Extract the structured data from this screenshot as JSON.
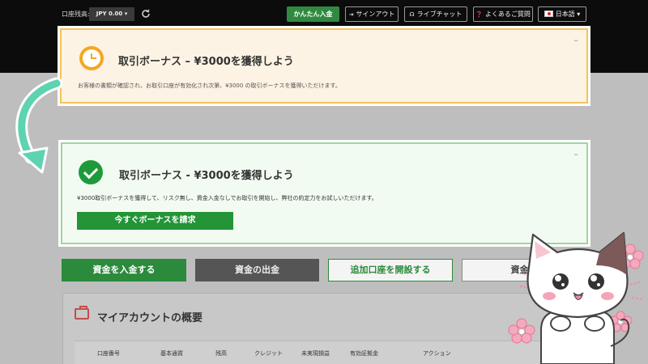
{
  "topbar": {
    "balance_label": "口座残高:",
    "currency": "JPY 0.00 ▾",
    "deposit_label": "かんたん入金",
    "signout_label": "サインアウト",
    "livechat_label": "ライブチャット",
    "faq_label": "よくあるご質問",
    "language_label": "日本語 ▾"
  },
  "pending_bonus": {
    "title": "取引ボーナス – ¥3000を獲得しよう",
    "description": "お客様の書類が確認され、お取引口座が有効化され次第、¥3000 の取引ボーナスを獲得いただけます。",
    "minimize": "–"
  },
  "active_bonus": {
    "title": "取引ボーナス - ¥3000を獲得しよう",
    "description": "¥3000取引ボーナスを獲得して、リスク無し、資金入金なしでお取引を開始し、弊社の約定力をお試しいただけます。",
    "claim_label": "今すぐボーナスを請求",
    "minimize": "–"
  },
  "actions": {
    "deposit": "資金を入金する",
    "withdraw": "資金の出金",
    "open_account": "追加口座を開設する",
    "transfer": "資金移"
  },
  "overview": {
    "title": "マイアカウントの概要",
    "columns": [
      "口座番号",
      "基本通貨",
      "残高",
      "クレジット",
      "未実現損益",
      "有効証拠金",
      "アクション"
    ]
  },
  "colors": {
    "brand_green": "#2b8a3b",
    "bonus_orange": "#f5a623",
    "success_green": "#1e9a3a"
  }
}
